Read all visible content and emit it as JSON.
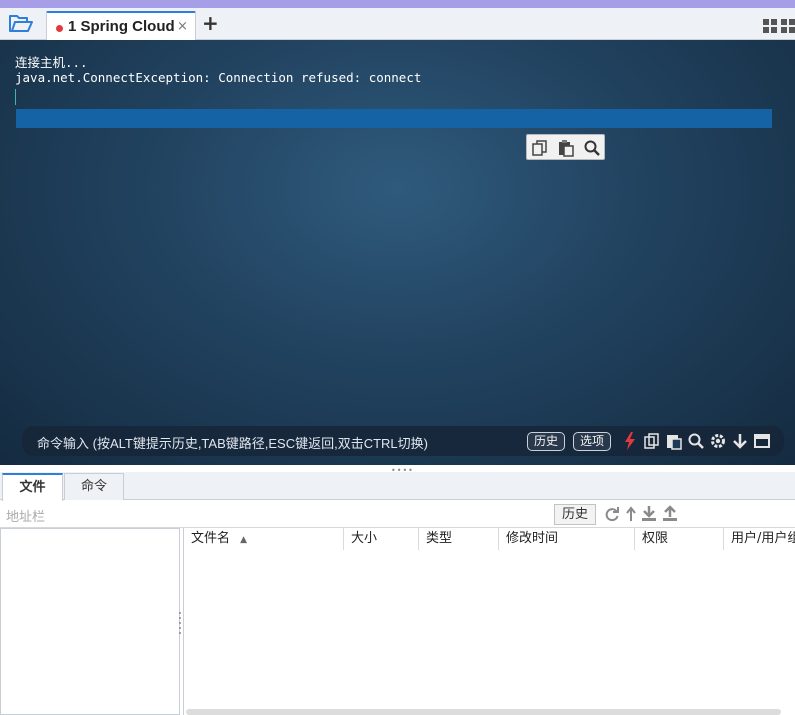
{
  "tabbar": {
    "tab_title": "1 Spring Cloud",
    "close_glyph": "×",
    "add_glyph": "+",
    "folder_icon": "folder-open-icon",
    "layout_icon": "grid-layout-icon"
  },
  "terminal": {
    "lines": [
      "连接主机...",
      "java.net.ConnectException: Connection refused: connect"
    ],
    "selection_color": "#1563a5",
    "float_tools": [
      "copy-icon",
      "paste-icon",
      "search-icon"
    ]
  },
  "command_bar": {
    "hint": "命令输入 (按ALT键提示历史,TAB键路径,ESC键返回,双击CTRL切换)",
    "history_label": "历史",
    "options_label": "选项",
    "icons": [
      "lightning-icon",
      "copy-icon",
      "paste-icon",
      "search-icon",
      "settings-icon",
      "arrow-down-icon",
      "window-icon"
    ]
  },
  "panel_tabs": [
    {
      "label": "文件",
      "active": true
    },
    {
      "label": "命令",
      "active": false
    }
  ],
  "address_bar": {
    "placeholder": "地址栏",
    "history_label": "历史",
    "tools": [
      "refresh-icon",
      "up-arrow-icon",
      "download-icon",
      "upload-icon"
    ]
  },
  "file_table": {
    "columns": [
      "文件名",
      "大小",
      "类型",
      "修改时间",
      "权限",
      "用户/用户组"
    ],
    "sort_indicator": "▲",
    "rows": []
  },
  "colors": {
    "accent": "#2f7fd8",
    "top_strip": "#a79ee8",
    "unsaved_dot": "#e4393c",
    "lightning": "#e4393c"
  }
}
